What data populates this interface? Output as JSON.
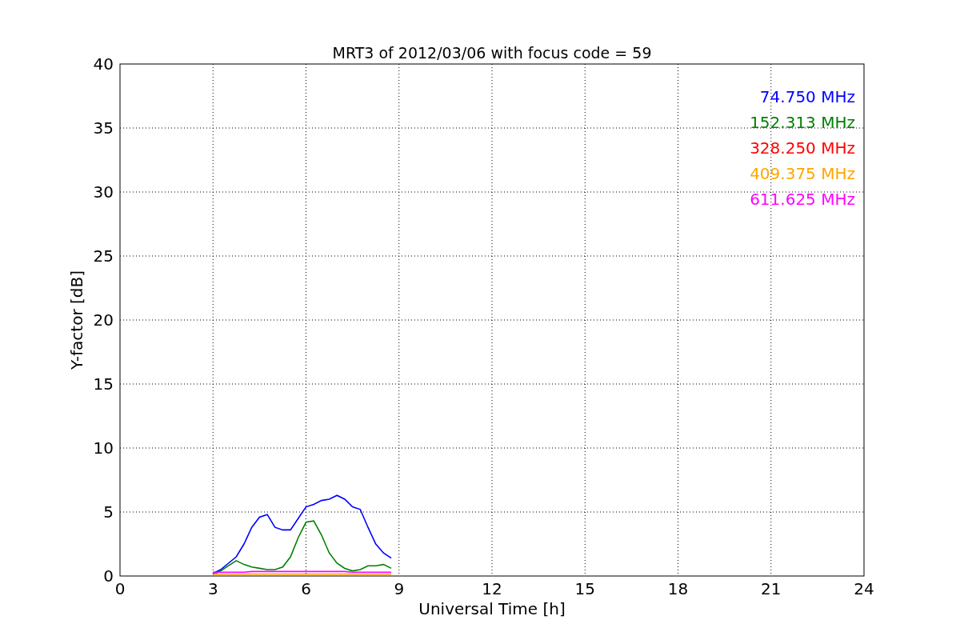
{
  "chart_data": {
    "type": "line",
    "title": "MRT3 of 2012/03/06 with focus code = 59",
    "xlabel": "Universal Time [h]",
    "ylabel": "Y-factor [dB]",
    "x": [
      3,
      3.25,
      3.5,
      3.75,
      4,
      4.25,
      4.5,
      4.75,
      5,
      5.25,
      5.5,
      5.75,
      6,
      6.25,
      6.5,
      6.75,
      7,
      7.25,
      7.5,
      7.75,
      8,
      8.25,
      8.5,
      8.75
    ],
    "xlim": [
      0,
      24
    ],
    "ylim": [
      0,
      40
    ],
    "xticks": [
      0,
      3,
      6,
      9,
      12,
      15,
      18,
      21,
      24
    ],
    "yticks": [
      0,
      5,
      10,
      15,
      20,
      25,
      30,
      35,
      40
    ],
    "grid": true,
    "series": [
      {
        "name": "74.750 MHz",
        "color": "#0000ff",
        "values": [
          0.2,
          0.5,
          1.0,
          1.5,
          2.5,
          3.8,
          4.6,
          4.8,
          3.8,
          3.6,
          3.6,
          4.5,
          5.4,
          5.6,
          5.9,
          6.0,
          6.3,
          6.0,
          5.4,
          5.2,
          3.8,
          2.5,
          1.8,
          1.4
        ]
      },
      {
        "name": "152.313 MHz",
        "color": "#008000",
        "values": [
          0.1,
          0.4,
          0.8,
          1.2,
          0.9,
          0.7,
          0.6,
          0.5,
          0.5,
          0.7,
          1.5,
          3.0,
          4.2,
          4.3,
          3.2,
          1.8,
          1.0,
          0.6,
          0.4,
          0.5,
          0.8,
          0.8,
          0.9,
          0.6
        ]
      },
      {
        "name": "328.250 MHz",
        "color": "#ff0000",
        "values": [
          null,
          null,
          null,
          null,
          null,
          null,
          null,
          null,
          null,
          null,
          null,
          null,
          null,
          null,
          null,
          null,
          null,
          null,
          null,
          null,
          null,
          null,
          null,
          null
        ]
      },
      {
        "name": "409.375 MHz",
        "color": "#ffa500",
        "values": [
          0.15,
          0.15,
          0.15,
          0.15,
          0.15,
          0.15,
          0.15,
          0.15,
          0.15,
          0.15,
          0.15,
          0.15,
          0.15,
          0.15,
          0.15,
          0.15,
          0.15,
          0.15,
          0.15,
          0.15,
          0.15,
          0.15,
          0.15,
          0.15
        ]
      },
      {
        "name": "611.625 MHz",
        "color": "#ff00ff",
        "values": [
          0.3,
          0.3,
          0.3,
          0.3,
          0.3,
          0.35,
          0.35,
          0.35,
          0.35,
          0.35,
          0.35,
          0.35,
          0.35,
          0.35,
          0.35,
          0.35,
          0.35,
          0.35,
          0.3,
          0.3,
          0.3,
          0.3,
          0.3,
          0.3
        ]
      }
    ]
  }
}
